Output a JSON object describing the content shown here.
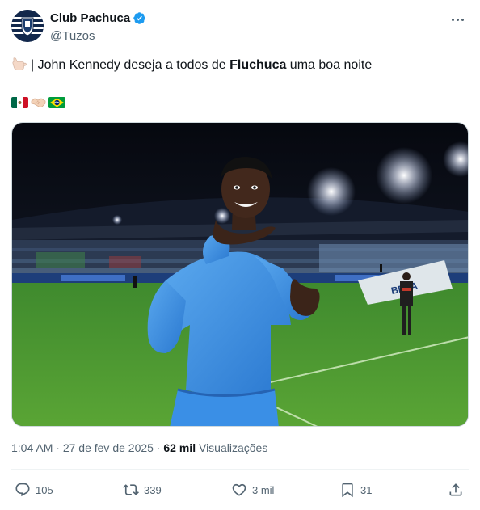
{
  "author": {
    "display_name": "Club Pachuca",
    "handle": "@Tuzos",
    "avatar_icon": "club-pachuca-crest-icon",
    "verified_icon": "verified-badge-icon"
  },
  "tweet": {
    "text_part1": "| John Kennedy deseja a todos de ",
    "text_bold": "Fluchuca",
    "text_part2": " uma boa noite",
    "leading_emoji": "call-me-hand-emoji",
    "flags": [
      "mexico-flag",
      "handshake-emoji",
      "brazil-flag"
    ]
  },
  "media": {
    "description_icon": "stadium-photo"
  },
  "meta": {
    "time": "1:04 AM",
    "sep1": " · ",
    "date": "27 de fev de 2025",
    "sep2": " · ",
    "views_count": "62 mil",
    "views_label": " Visualizações"
  },
  "actions": {
    "reply_count": "105",
    "retweet_count": "339",
    "like_count": "3 mil",
    "bookmark_count": "31"
  },
  "colors": {
    "text": "#0f1419",
    "secondary": "#536471",
    "verified": "#1d9bf0",
    "divider": "#eff3f4"
  }
}
